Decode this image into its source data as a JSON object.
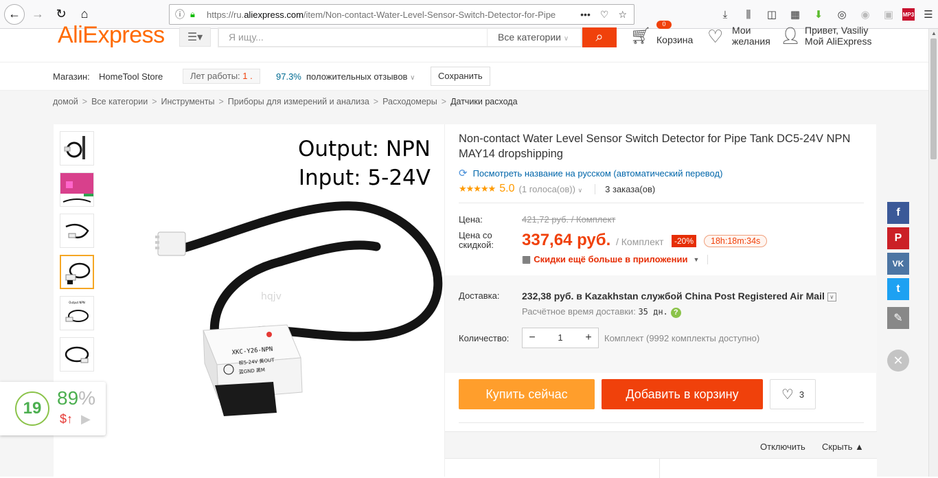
{
  "browser": {
    "url_prefix": "https://ru.",
    "url_domain": "aliexpress.com",
    "url_rest": "/item/Non-contact-Water-Level-Sensor-Switch-Detector-for-Pipe",
    "mp3_label": "MP3"
  },
  "header": {
    "logo": "AliExpress",
    "search_placeholder": "Я ищу...",
    "search_category": "Все категории",
    "cart_count": "0",
    "cart_label": "Корзина",
    "wishlist_line1": "Мои",
    "wishlist_line2": "желания",
    "account_line1": "Привет, Vasiliy",
    "account_line2": "Мой AliExpress"
  },
  "store": {
    "label": "Магазин:",
    "name": "HomeTool Store",
    "years_label": "Лет работы:",
    "years_value": "1 .",
    "positive_pct": "97.3%",
    "positive_label": "положительных отзывов",
    "save_label": "Сохранить"
  },
  "breadcrumb": [
    "домой",
    "Все категории",
    "Инструменты",
    "Приборы для измерений и анализа",
    "Расходомеры",
    "Датчики расхода"
  ],
  "gallery": {
    "overlay_line1": "Output: NPN",
    "overlay_line2": "Input: 5-24V",
    "watermark": "hqjv",
    "label_model": "XKC-Y26-NPN",
    "label_pins": "棕5-24V  黄OUT",
    "label_gnd": "蓝GND  黑M"
  },
  "product": {
    "title": "Non-contact Water Level Sensor Switch Detector for Pipe Tank DC5-24V NPN MAY14 dropshipping",
    "translate_link": "Посмотреть название на русском (автоматический перевод)",
    "stars": "★★★★★",
    "score": "5.0",
    "votes": "(1 голоса(ов))",
    "orders": "3 заказа(ов)",
    "price_label": "Цена:",
    "old_price": "421,72 руб. / Комплект",
    "discount_label_1": "Цена со",
    "discount_label_2": "скидкой:",
    "new_price": "337,64 руб.",
    "unit": "/ Комплект",
    "discount": "-20%",
    "timer": "18h:18m:34s",
    "app_deal": "Скидки ещё больше в приложении",
    "shipping_label": "Доставка:",
    "shipping_text": "232,38 руб. в Kazakhstan службой China Post Registered Air Mail",
    "delivery_time_label": "Расчётное время доставки:",
    "delivery_time_value": "35 дн.",
    "quantity_label": "Количество:",
    "quantity_value": "1",
    "quantity_info": "Комплект (9992 комплекты доступно)",
    "buy_now": "Купить сейчас",
    "add_to_cart": "Добавить в корзину",
    "wish_count": "3",
    "disable_label": "Отключить",
    "hide_label": "Скрыть ▲"
  },
  "widget": {
    "score": "19",
    "percent": "89",
    "percent_sign": "%",
    "dollar": "$↑"
  },
  "social": {
    "fb": "f",
    "pin": "P",
    "vk": "VK",
    "tw": "t"
  }
}
